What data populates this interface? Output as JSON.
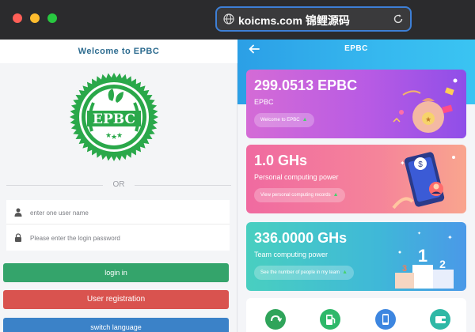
{
  "browser": {
    "url": "koicms.com 锦鲤源码"
  },
  "login_page": {
    "header_title": "Welcome to EPBC",
    "logo_text": "EPBC",
    "separator_text": "OR",
    "username_placeholder": "enter one user name",
    "password_placeholder": "Please enter the login password",
    "login_label": "login in",
    "register_label": "User registration",
    "language_label": "switch language"
  },
  "dashboard": {
    "title": "EPBC",
    "cards": [
      {
        "value": "299.0513 EPBC",
        "label": "EPBC",
        "button": "Welcome to EPBC",
        "color": "#b85be4"
      },
      {
        "value": "1.0 GHs",
        "label": "Personal computing power",
        "button": "View personal computing records",
        "color": "#f5849a"
      },
      {
        "value": "336.0000 GHs",
        "label": "Team computing power",
        "button": "See the number of people in my team",
        "color": "#3fb8d8"
      }
    ],
    "bottom_icons": [
      "refresh-icon",
      "fuel-icon",
      "phone-icon",
      "wallet-icon"
    ]
  },
  "colors": {
    "login_button": "#34a46b",
    "register_button": "#d9534f",
    "language_button": "#3b82c8",
    "header_accent": "#2b9fe6"
  }
}
